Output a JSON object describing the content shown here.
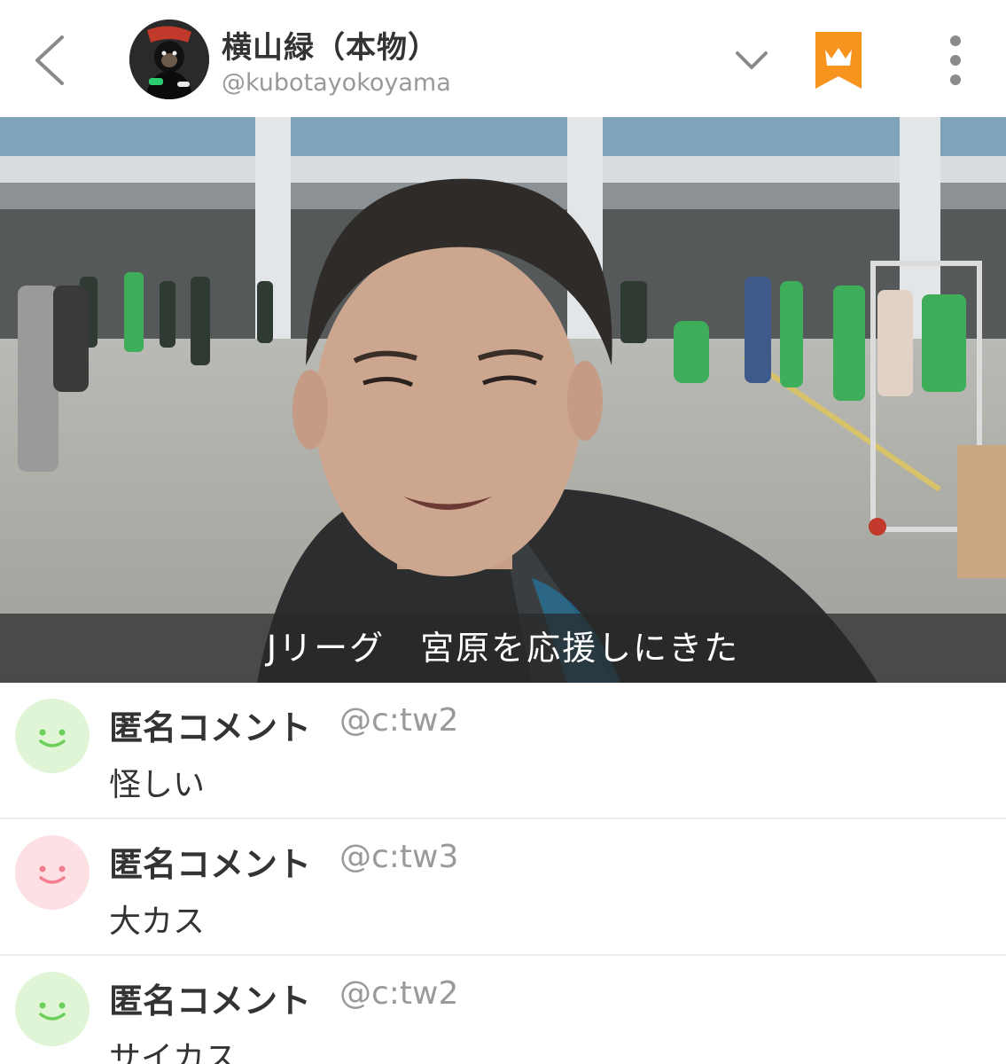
{
  "header": {
    "title": "横山緑（本物）",
    "handle": "@kubotayokoyama",
    "back_icon": "chevron-left-icon",
    "dropdown_icon": "chevron-down-icon",
    "bookmark_icon": "crown-bookmark-icon",
    "more_icon": "more-vertical-icon",
    "accent_color": "#f7941d"
  },
  "video": {
    "caption": "Jリーグ　宮原を応援しにきた"
  },
  "comments": [
    {
      "name": "匿名コメント",
      "id": "@c:tw2",
      "text": "怪しい",
      "avatar_color": "#dff5d6",
      "face_color": "#6ccf5a"
    },
    {
      "name": "匿名コメント",
      "id": "@c:tw3",
      "text": "大カス",
      "avatar_color": "#fde0e3",
      "face_color": "#f27e8e"
    },
    {
      "name": "匿名コメント",
      "id": "@c:tw2",
      "text": "サイカス",
      "avatar_color": "#dff5d6",
      "face_color": "#6ccf5a"
    }
  ]
}
